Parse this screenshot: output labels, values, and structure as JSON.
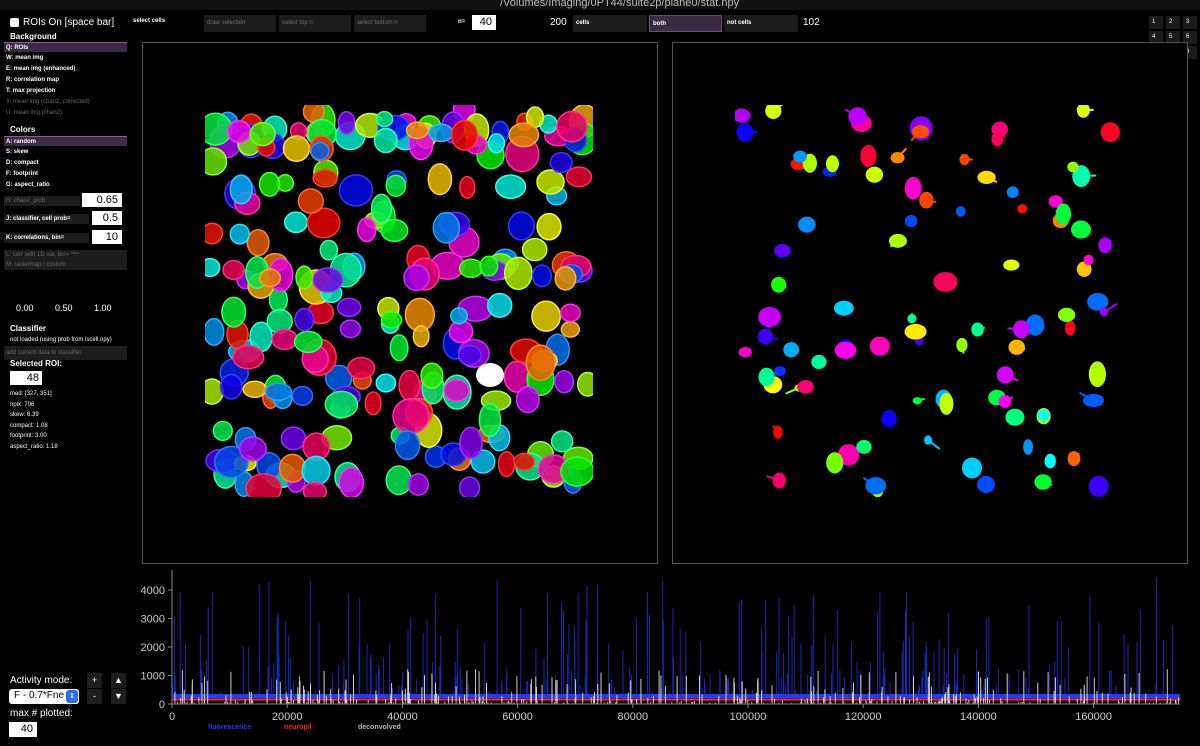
{
  "window": {
    "title": "/Volumes/Imaging/0PT44/suite2p/plane0/stat.npy"
  },
  "rois_toggle": {
    "label": "ROIs On [space bar]",
    "checked": false
  },
  "background": {
    "title": "Background",
    "items": [
      {
        "label": "Q: ROIs",
        "state": "selected"
      },
      {
        "label": "W: mean img",
        "state": "enabled"
      },
      {
        "label": "E: mean img (enhanced)",
        "state": "enabled"
      },
      {
        "label": "R: correlation map",
        "state": "enabled"
      },
      {
        "label": "T: max projection",
        "state": "enabled"
      },
      {
        "label": "Y: mean img (chan2, corrected)",
        "state": "disabled"
      },
      {
        "label": "U: mean img (chan2)",
        "state": "disabled"
      }
    ]
  },
  "colors": {
    "title": "Colors",
    "items": [
      {
        "label": "A: random",
        "state": "selected"
      },
      {
        "label": "S: skew",
        "state": "enabled"
      },
      {
        "label": "D: compact",
        "state": "enabled"
      },
      {
        "label": "F: footprint",
        "state": "enabled"
      },
      {
        "label": "G: aspect_ratio",
        "state": "enabled"
      }
    ],
    "chan2_label": "H: chan2_prob",
    "chan2_value": "0.65",
    "classifier_label": "J: classifier, cell prob=",
    "classifier_value": "0.5",
    "correlations_label": "K: correlations, bin=",
    "correlations_value": "10",
    "corr1d_label": "L: corr with 1D var, bin= ^^^",
    "rastermap_label": "M: rastermap / custom"
  },
  "colorbar": {
    "min": "0.00",
    "mid": "0.50",
    "max": "1.00"
  },
  "classifier": {
    "title": "Classifier",
    "status": "not loaded (using prob from iscell.npy)",
    "add_button": "add current data to classifier"
  },
  "selected_roi": {
    "title": "Selected ROI:",
    "value": "48",
    "stats": [
      "med: [327, 351]",
      "npix: 706",
      "skew: 6.39",
      "compact: 1.08",
      "footprint: 3.00",
      "aspect_ratio: 1.18"
    ]
  },
  "topbar": {
    "select_cells_label": "select cells",
    "draw_selection": "draw selection",
    "select_top_n": "select top n",
    "select_bottom_n": "select bottom n",
    "n_label": "n=",
    "n_value": "40",
    "cells_count": "200",
    "cells_btn": "cells",
    "both_btn": "both",
    "not_cells_btn": "not cells",
    "not_cells_count": "102"
  },
  "view_grid": {
    "buttons": [
      "1",
      "2",
      "3",
      "4",
      "5",
      "6",
      "7",
      "8",
      "9"
    ]
  },
  "activity": {
    "mode_label": "Activity mode:",
    "mode_value": "F - 0.7*Fneu",
    "max_plotted_label": "max # plotted:",
    "max_plotted_value": "40",
    "plus": "+",
    "minus": "-",
    "up": "▲",
    "down": "▼"
  },
  "chart_data": {
    "type": "line",
    "title": "",
    "xlabel": "",
    "ylabel": "",
    "xlim": [
      0,
      175000
    ],
    "ylim": [
      0,
      4700
    ],
    "xticks": [
      "0",
      "20000",
      "40000",
      "60000",
      "80000",
      "100000",
      "120000",
      "140000",
      "160000"
    ],
    "yticks": [
      "0",
      "1000",
      "2000",
      "3000",
      "4000"
    ],
    "series": [
      {
        "name": "fluorescence",
        "color": "#1f3dff",
        "baseline": 260
      },
      {
        "name": "neuropil",
        "color": "#ff2020",
        "baseline": 160
      },
      {
        "name": "deconvolved",
        "color": "#ffffff",
        "baseline": 20
      }
    ]
  }
}
